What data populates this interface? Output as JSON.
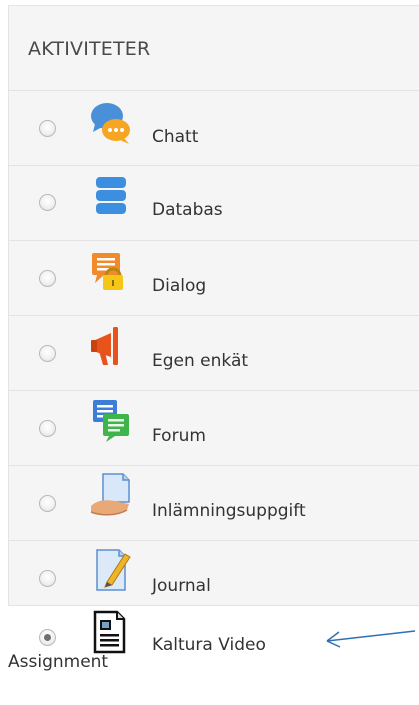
{
  "panel": {
    "title": "AKTIVITETER",
    "items": [
      {
        "label": "Chatt",
        "icon": "chat-icon",
        "selected": false
      },
      {
        "label": "Databas",
        "icon": "database-icon",
        "selected": false
      },
      {
        "label": "Dialog",
        "icon": "dialog-icon",
        "selected": false
      },
      {
        "label": "Egen enkät",
        "icon": "megaphone-icon",
        "selected": false
      },
      {
        "label": "Forum",
        "icon": "forum-icon",
        "selected": false
      },
      {
        "label": "Inlämningsuppgift",
        "icon": "assignment-icon",
        "selected": false
      },
      {
        "label": "Journal",
        "icon": "journal-icon",
        "selected": false
      },
      {
        "label_line1": "Kaltura Video",
        "label_line2": "Assignment",
        "icon": "kaltura-video-icon",
        "selected": true
      }
    ]
  },
  "colors": {
    "panel_bg": "#f5f5f5",
    "arrow": "#2e6fb5"
  }
}
